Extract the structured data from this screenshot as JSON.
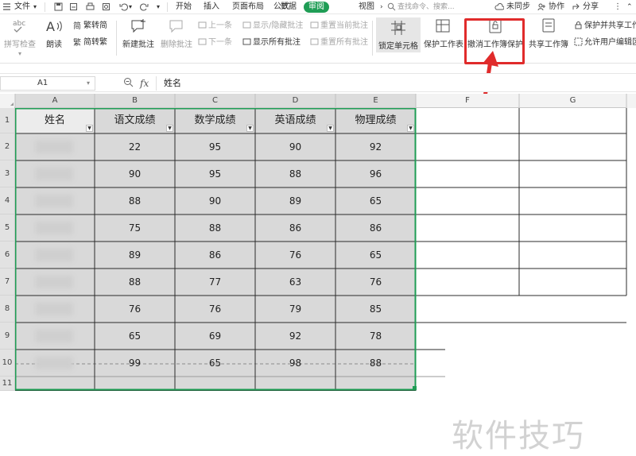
{
  "menubar": {
    "file": "文件",
    "tabs": [
      "开始",
      "插入",
      "页面布局",
      "公式",
      "数据"
    ],
    "active_tab": "审阅",
    "view": "视图",
    "search_placeholder": "查找命令、搜索...",
    "sync": "未同步",
    "collab": "协作",
    "share": "分享"
  },
  "ribbon": {
    "spellcheck": "拼写检查",
    "read_aloud": "朗读",
    "trad_simp": "繁转简",
    "simp_trad": "简转繁",
    "new_comment": "新建批注",
    "delete_comment": "删除批注",
    "prev": "上一条",
    "next": "下一条",
    "show_hide_comment": "显示/隐藏批注",
    "show_all_comments": "显示所有批注",
    "reset_current": "重置当前批注",
    "reset_all": "重置所有批注",
    "lock_cell": "锁定单元格",
    "protect_sheet": "保护工作表",
    "unprotect_workbook": "撤消工作簿保护",
    "share_workbook": "共享工作簿",
    "protect_share": "保护并共享工作",
    "allow_edit": "允许用户编辑区"
  },
  "formula_bar": {
    "cell_ref": "A1",
    "fx": "fx",
    "content": "姓名"
  },
  "sheet": {
    "columns": [
      "A",
      "B",
      "C",
      "D",
      "E",
      "F",
      "G"
    ],
    "rows": [
      "1",
      "2",
      "3",
      "4",
      "5",
      "6",
      "7",
      "8",
      "9",
      "10",
      "11"
    ],
    "headers": [
      "姓名",
      "语文成绩",
      "数学成绩",
      "英语成绩",
      "物理成绩"
    ],
    "data": [
      [
        "22",
        "95",
        "90",
        "92"
      ],
      [
        "90",
        "95",
        "88",
        "96"
      ],
      [
        "88",
        "90",
        "89",
        "65"
      ],
      [
        "75",
        "88",
        "86",
        "86"
      ],
      [
        "89",
        "86",
        "76",
        "65"
      ],
      [
        "88",
        "77",
        "63",
        "76"
      ],
      [
        "76",
        "76",
        "79",
        "85"
      ],
      [
        "65",
        "69",
        "92",
        "78"
      ],
      [
        "99",
        "65",
        "98",
        "88"
      ]
    ],
    "selection_color": "#1f9d55",
    "shade_color": "#d9d9d9"
  },
  "watermark": "软件技巧",
  "accent": "#1f9d55",
  "annotation_color": "#e02b2b"
}
